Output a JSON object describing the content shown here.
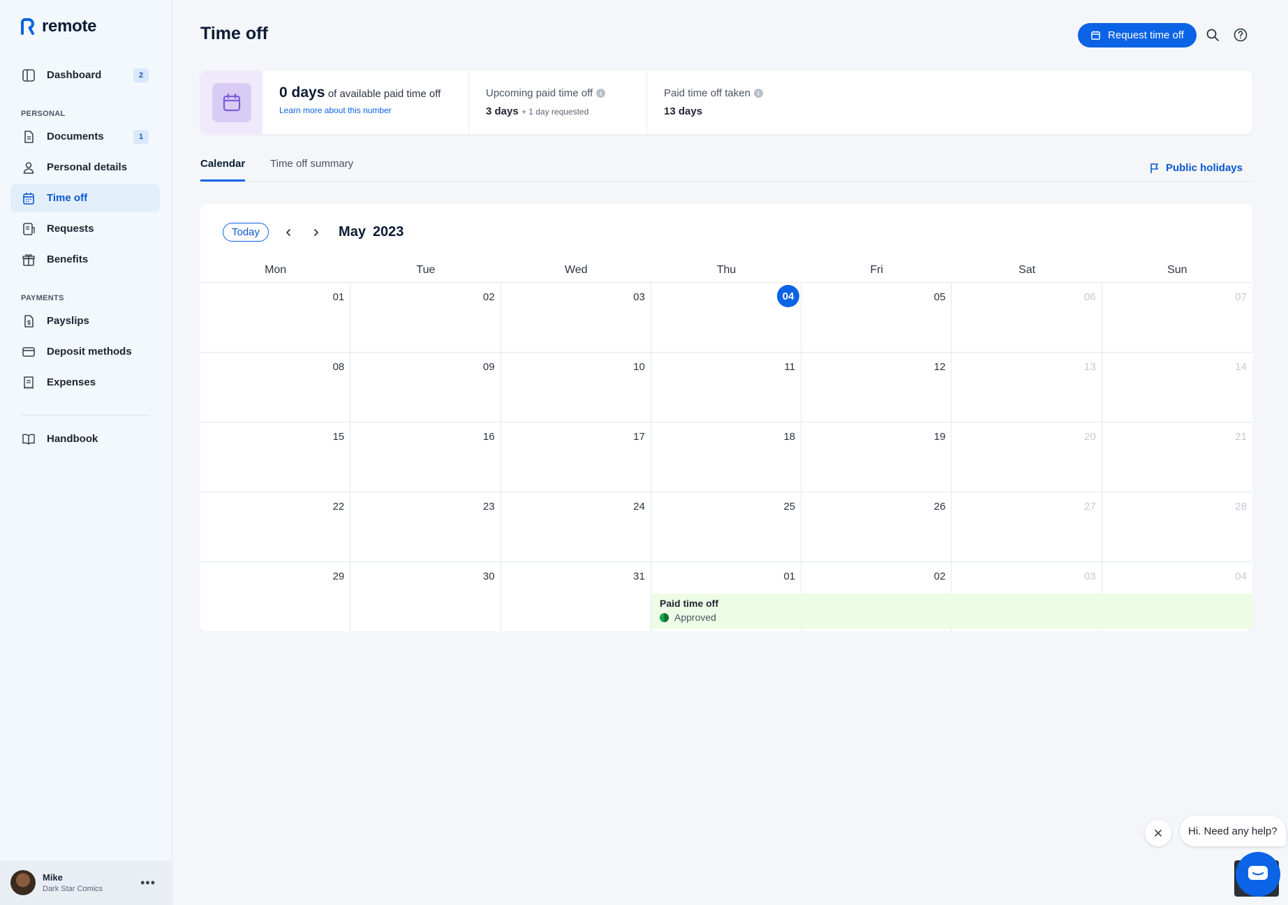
{
  "brand": {
    "name": "remote",
    "accent": "#0b63e5"
  },
  "sidebar": {
    "items": [
      {
        "key": "dashboard",
        "label": "Dashboard",
        "badge": "2",
        "icon": "dashboard-icon"
      },
      {
        "key": "documents",
        "label": "Documents",
        "badge": "1",
        "icon": "document-icon"
      },
      {
        "key": "personal-details",
        "label": "Personal details",
        "icon": "person-icon"
      },
      {
        "key": "time-off",
        "label": "Time off",
        "icon": "calendar-icon",
        "active": true
      },
      {
        "key": "requests",
        "label": "Requests",
        "icon": "requests-icon"
      },
      {
        "key": "benefits",
        "label": "Benefits",
        "icon": "gift-icon"
      },
      {
        "key": "payslips",
        "label": "Payslips",
        "icon": "payslip-icon"
      },
      {
        "key": "deposit-methods",
        "label": "Deposit methods",
        "icon": "card-icon"
      },
      {
        "key": "expenses",
        "label": "Expenses",
        "icon": "receipt-icon"
      },
      {
        "key": "handbook",
        "label": "Handbook",
        "icon": "book-icon"
      }
    ],
    "sections": {
      "personal": "PERSONAL",
      "payments": "PAYMENTS"
    },
    "user": {
      "name": "Mike",
      "company": "Dark Star Comics",
      "more": "..."
    }
  },
  "header": {
    "title": "Time off",
    "request_button": "Request time off"
  },
  "summary": {
    "available_days": "0 days",
    "available_suffix": "of available paid time off",
    "learn_more": "Learn more about this number",
    "upcoming_label": "Upcoming paid time off",
    "upcoming_value": "3 days",
    "upcoming_sub": "+ 1 day requested",
    "taken_label": "Paid time off taken",
    "taken_value": "13 days"
  },
  "tabs": [
    {
      "label": "Calendar",
      "active": true
    },
    {
      "label": "Time off summary"
    }
  ],
  "public_holidays": "Public holidays",
  "calendar": {
    "today_button": "Today",
    "month": "May",
    "year": "2023",
    "weekdays": [
      "Mon",
      "Tue",
      "Wed",
      "Thu",
      "Fri",
      "Sat",
      "Sun"
    ],
    "weeks": [
      [
        "01",
        "02",
        "03",
        "04",
        "05",
        "06",
        "07"
      ],
      [
        "08",
        "09",
        "10",
        "11",
        "12",
        "13",
        "14"
      ],
      [
        "15",
        "16",
        "17",
        "18",
        "19",
        "20",
        "21"
      ],
      [
        "22",
        "23",
        "24",
        "25",
        "26",
        "27",
        "28"
      ],
      [
        "29",
        "30",
        "31",
        "01",
        "02",
        "03",
        "04"
      ]
    ],
    "today": "04",
    "event": {
      "title": "Paid time off",
      "status": "Approved"
    }
  },
  "help": {
    "message": "Hi. Need any help?"
  }
}
